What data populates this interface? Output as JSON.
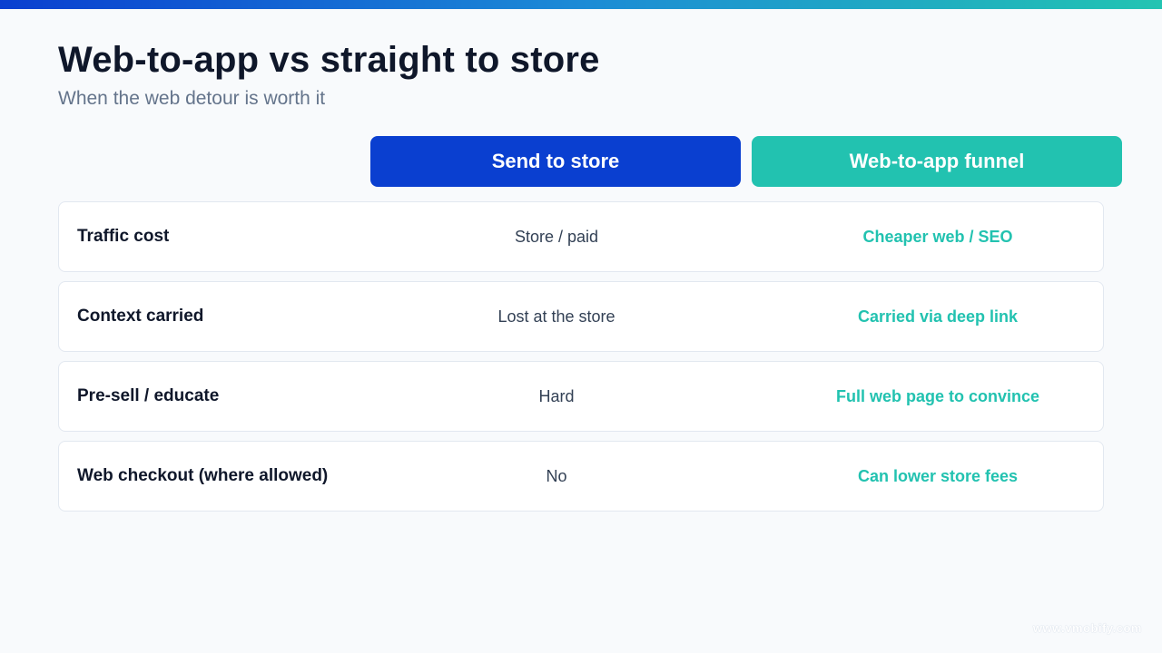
{
  "title": "Web-to-app vs straight to store",
  "subtitle": "When the web detour is worth it",
  "columns": {
    "store": "Send to store",
    "funnel": "Web-to-app funnel"
  },
  "rows": [
    {
      "label": "Traffic cost",
      "store": "Store / paid",
      "funnel": "Cheaper web / SEO"
    },
    {
      "label": "Context carried",
      "store": "Lost at the store",
      "funnel": "Carried via deep link"
    },
    {
      "label": "Pre-sell / educate",
      "store": "Hard",
      "funnel": "Full web page to convince"
    },
    {
      "label": "Web checkout (where allowed)",
      "store": "No",
      "funnel": "Can lower store fees"
    }
  ],
  "watermark": "www.vmobify.com",
  "colors": {
    "store_accent": "#0a3fd0",
    "funnel_accent": "#22c2b0",
    "title": "#0f172a",
    "subtitle": "#64748b"
  }
}
